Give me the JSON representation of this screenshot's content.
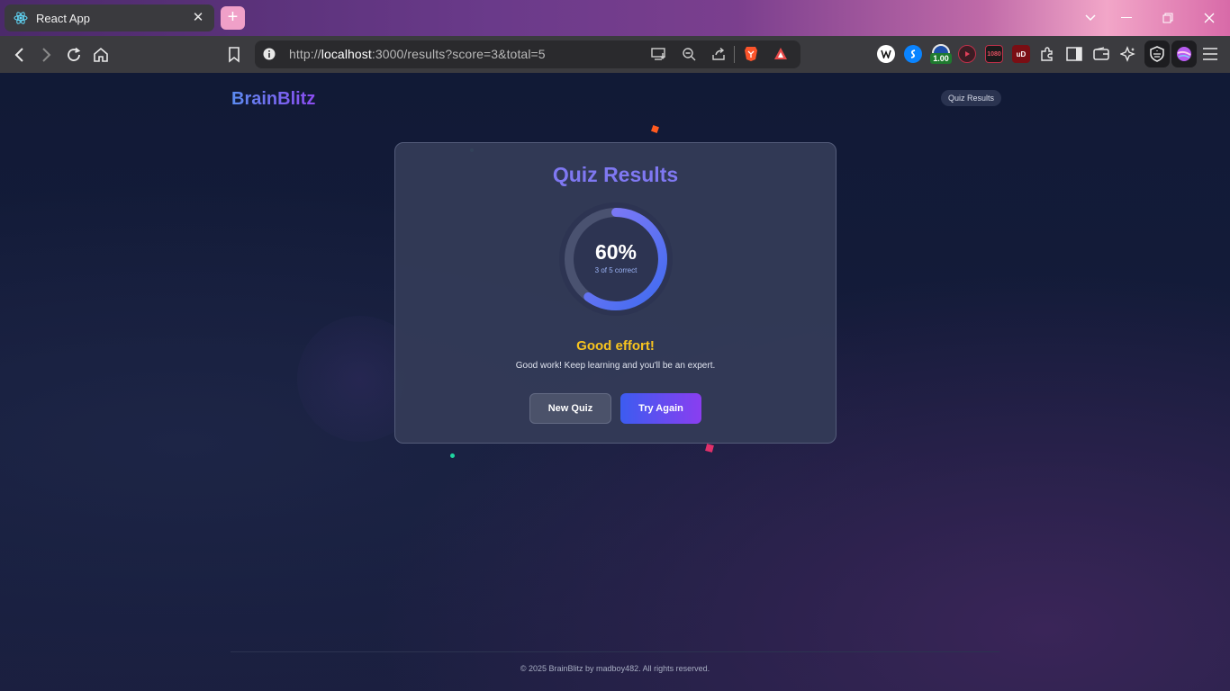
{
  "browser": {
    "tab_title": "React App",
    "tab_close": "✕",
    "new_tab": "+",
    "url_scheme": "http://",
    "url_host": "localhost",
    "url_rest": ":3000/results?score=3&total=5",
    "ext_badge": "1.00",
    "ext_res": "1080",
    "ext_ub": "uD"
  },
  "header": {
    "brand": "BrainBlitz",
    "nav_label": "Quiz Results"
  },
  "result": {
    "title": "Quiz Results",
    "percent_text": "60%",
    "percent_value": 0.6,
    "detail": "3 of 5 correct",
    "message_title": "Good effort!",
    "message_text": "Good work! Keep learning and you'll be an expert."
  },
  "actions": {
    "new_quiz": "New Quiz",
    "try_again": "Try Again"
  },
  "footer": {
    "text": "© 2025 BrainBlitz by madboy482. All rights reserved."
  },
  "colors": {
    "accent": "#7f78f2",
    "ring_start": "#3f6bf0",
    "ring_end": "#8c7cf6",
    "message": "#f7c31f"
  }
}
